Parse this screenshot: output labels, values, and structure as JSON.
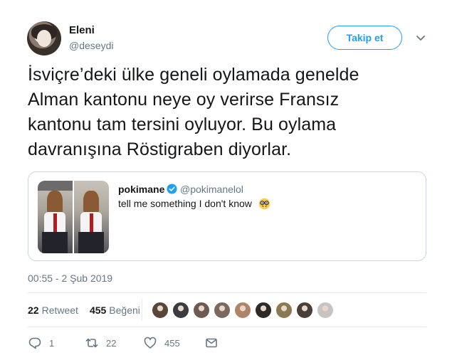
{
  "author": {
    "name": "Eleni",
    "handle": "@deseydi",
    "avatar_icon": "profile-photo"
  },
  "follow_button": {
    "label": "Takip et"
  },
  "tweet": {
    "lines": [
      "İsviçre’deki ülke geneli oylamada genelde",
      "Alman kantonu neye oy verirse Fransız",
      "kantonu tam tersini oyluyor. Bu oylama",
      "davranışına Röstigraben diyorlar."
    ]
  },
  "quoted": {
    "name": "pokimane",
    "verified": true,
    "handle": "@pokimanelol",
    "text": "tell me something I don't know",
    "emoji_icon": "nerd-face-emoji"
  },
  "timestamp": "00:55 - 2 Şub 2019",
  "stats": {
    "retweets_count": "22",
    "retweets_label": "Retweet",
    "likes_count": "455",
    "likes_label": "Beğeni"
  },
  "likers": [
    {
      "color": "#5a4636"
    },
    {
      "color": "#3b3b40"
    },
    {
      "color": "#6d5a52"
    },
    {
      "color": "#7a6a5e"
    },
    {
      "color": "#b08466"
    },
    {
      "color": "#2e2a28"
    },
    {
      "color": "#8a7a52"
    },
    {
      "color": "#4b4038"
    },
    {
      "color": "#c9c3c3"
    }
  ],
  "actions": {
    "reply_count": "1",
    "retweet_count": "22",
    "like_count": "455"
  },
  "colors": {
    "accent": "#1da1f2",
    "verified": "#1da1f2",
    "secondary_text": "#657786"
  }
}
